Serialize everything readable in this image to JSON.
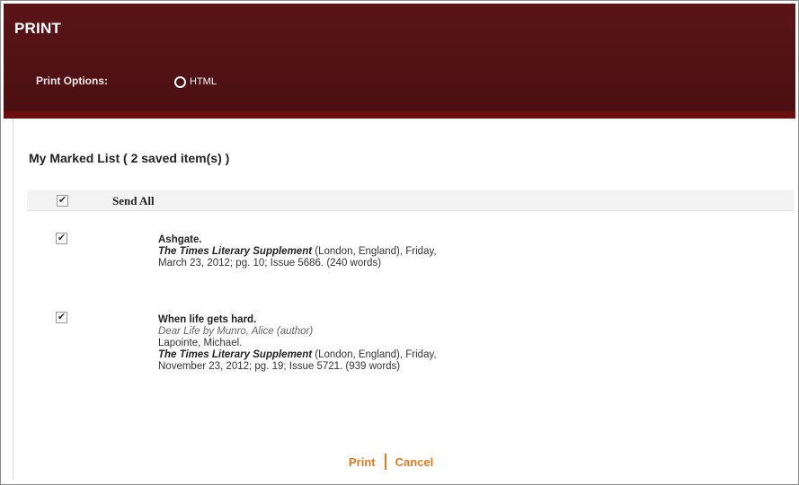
{
  "header": {
    "title": "PRINT",
    "print_options_label": "Print Options:",
    "format_option": "HTML"
  },
  "list": {
    "title": "My Marked List ( 2  saved item(s) )",
    "send_all": "Send All",
    "items": [
      {
        "title": "Ashgate.",
        "publication": "The Times Literary Supplement",
        "details": " (London, England), Friday,",
        "date_line": "March 23, 2012; pg. 10; Issue 5686.  (240 words)"
      },
      {
        "title": "When life gets hard.",
        "subtitle": "Dear Life by Munro, Alice (author)",
        "author": "Lapointe, Michael.",
        "publication": "The Times Literary Supplement",
        "details": " (London, England), Friday,",
        "date_line": "November 23, 2012; pg. 19; Issue 5721.  (939 words)"
      }
    ]
  },
  "actions": {
    "print": "Print",
    "cancel": "Cancel"
  },
  "colors": {
    "header_bg": "#4a1012",
    "accent": "#e07a1f"
  }
}
